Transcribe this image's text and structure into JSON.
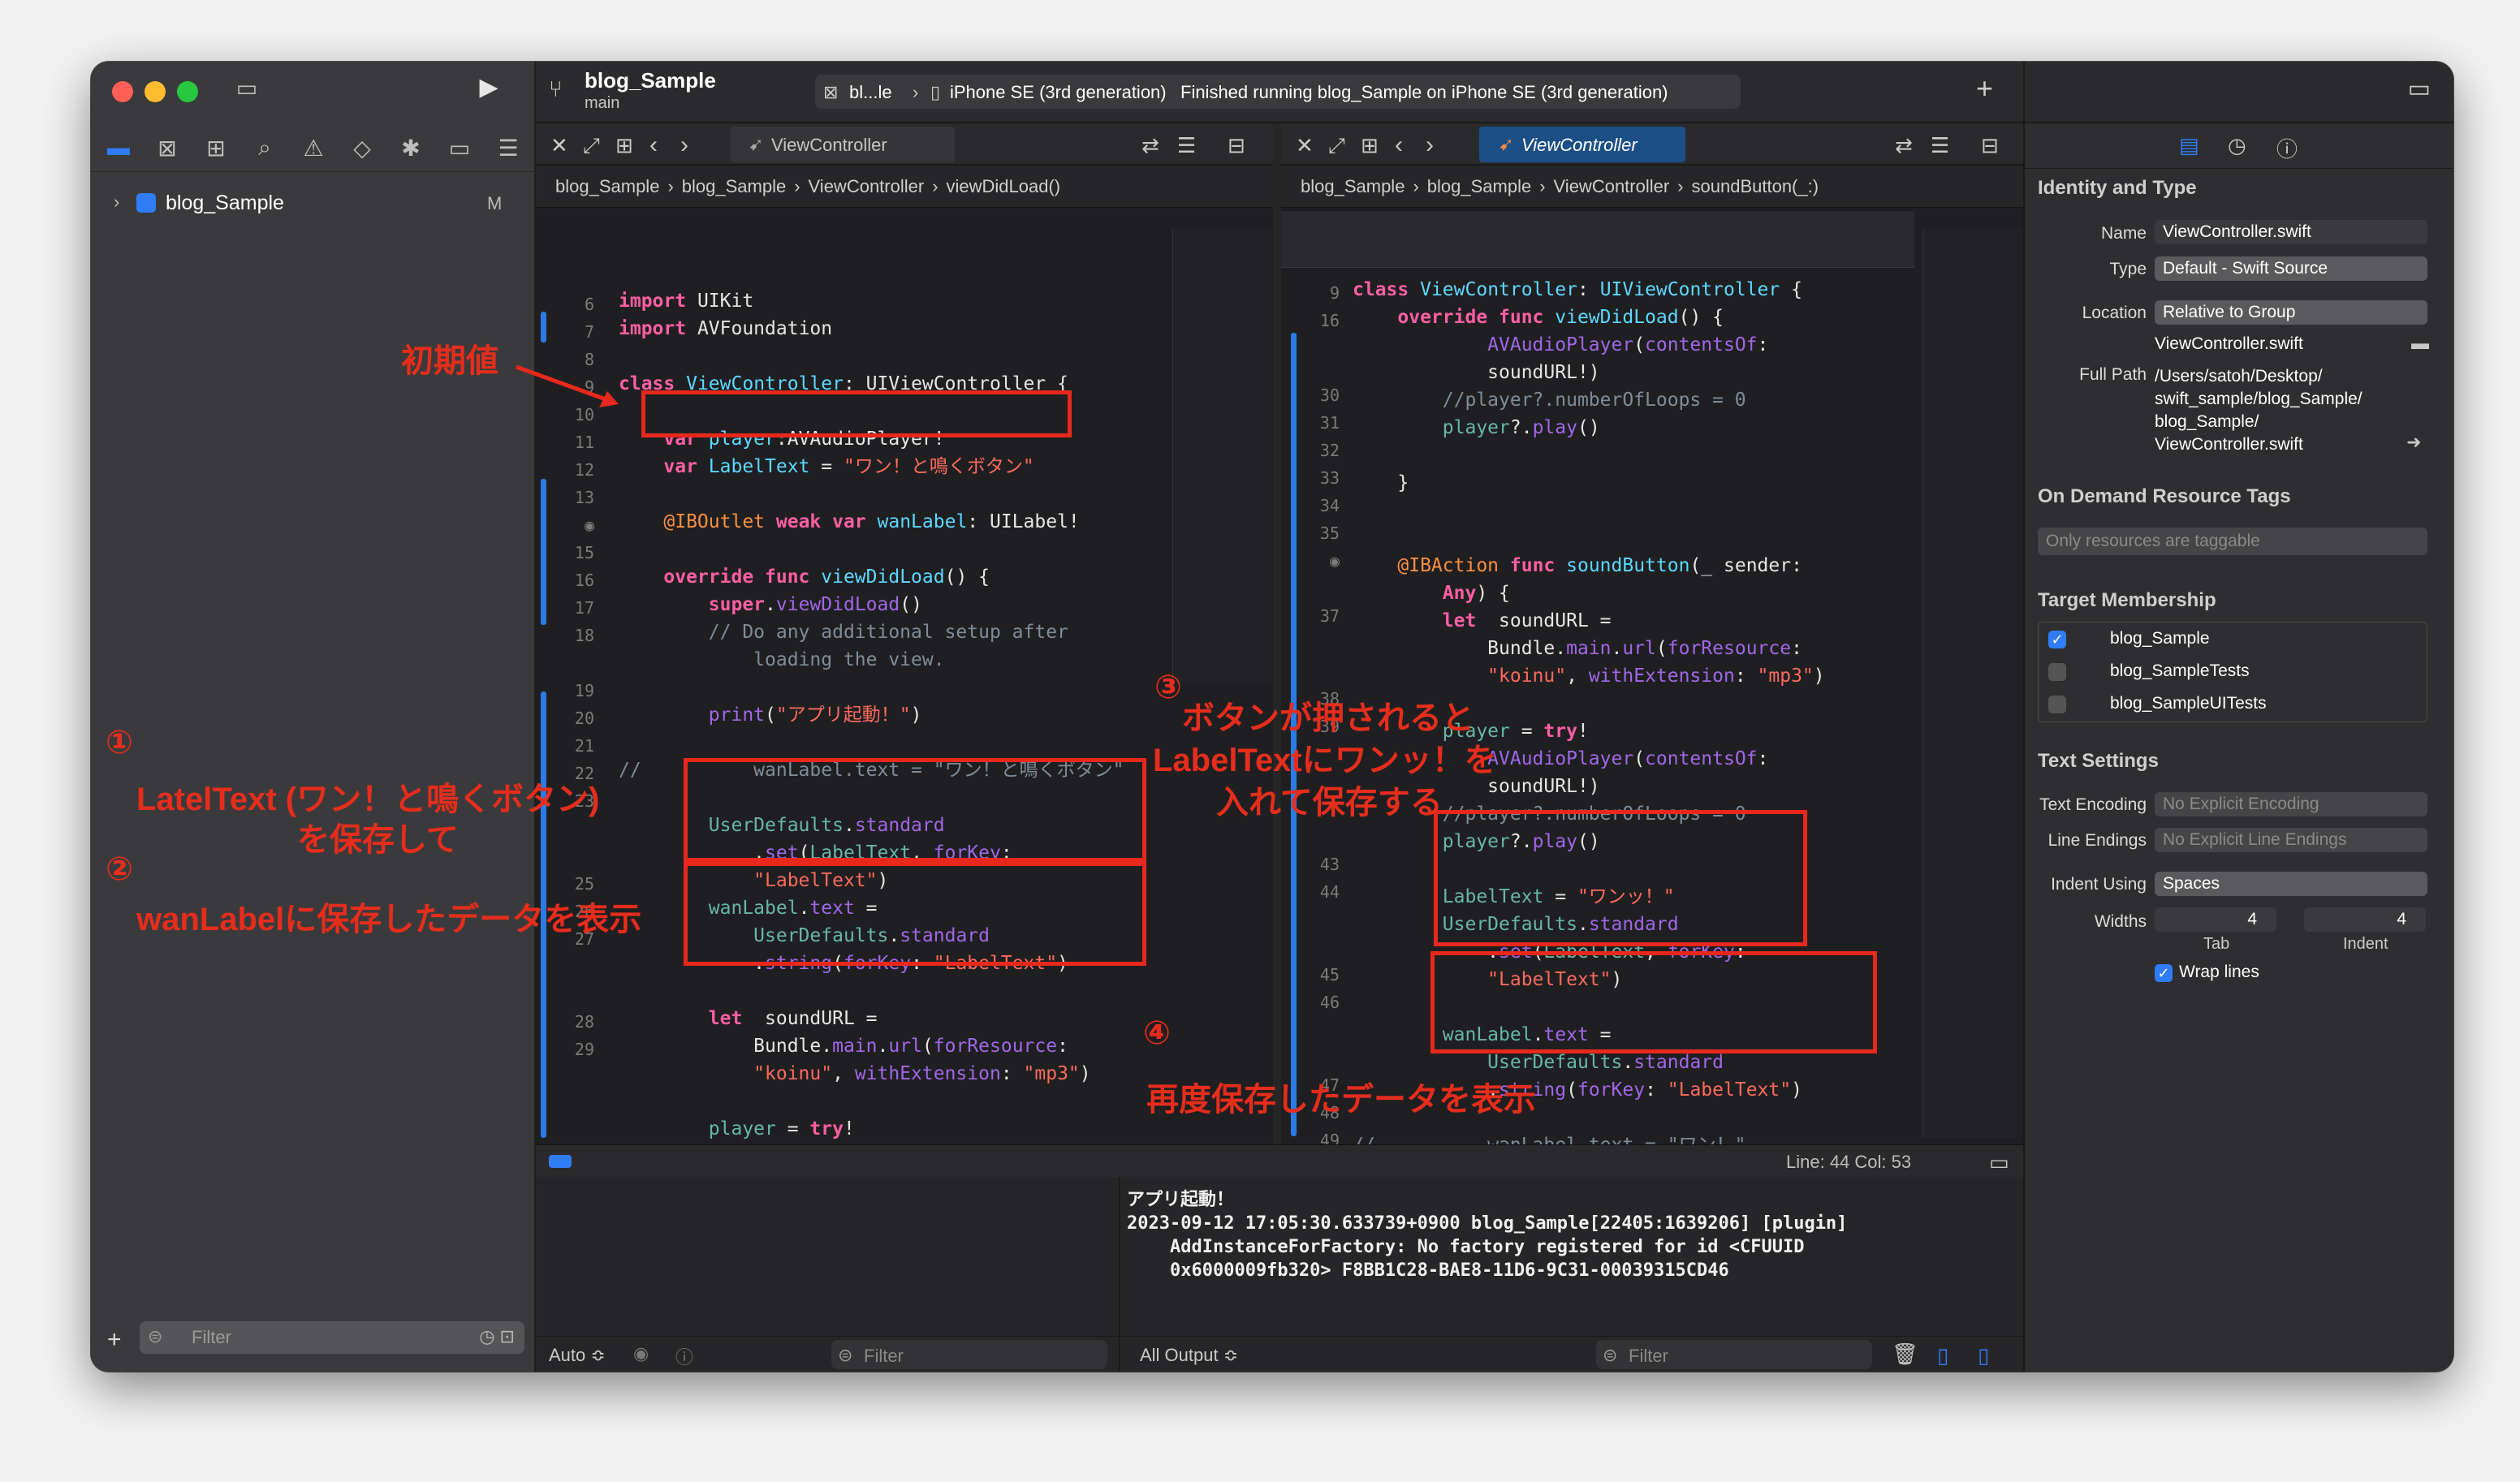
{
  "window": {
    "project": "blog_Sample",
    "branch": "main",
    "scheme": "bl...le",
    "device": "iPhone SE (3rd generation)",
    "status": "Finished running blog_Sample on iPhone SE (3rd generation)"
  },
  "navigator": {
    "project_item": "blog_Sample",
    "project_badge": "M",
    "filter_placeholder": "Filter"
  },
  "left_editor": {
    "tab": "ViewController",
    "breadcrumb": [
      "blog_Sample",
      "blog_Sample",
      "ViewController",
      "viewDidLoad()"
    ]
  },
  "right_editor": {
    "tab": "ViewController",
    "breadcrumb": [
      "blog_Sample",
      "blog_Sample",
      "ViewController",
      "soundButton(_:)"
    ]
  },
  "status_bar": {
    "position": "Line: 44  Col: 53"
  },
  "debug": {
    "auto_label": "Auto ≎",
    "filter_placeholder": "Filter",
    "output_label": "All Output ≎",
    "console_lines": [
      "アプリ起動！",
      "2023-09-12 17:05:30.633739+0900 blog_Sample[22405:1639206] [plugin]",
      "    AddInstanceForFactory: No factory registered for id <CFUUID",
      "    0x6000009fb320> F8BB1C28-BAE8-11D6-9C31-00039315CD46"
    ]
  },
  "annotations": {
    "initial": "初期値",
    "n1": "①",
    "n1_text_a": "LatelText (ワン！と鳴くボタン)",
    "n1_text_b": "を保存して",
    "n2": "②",
    "n2_text": "wanLabelに保存したデータを表示",
    "n3": "③",
    "n3_text_a": "ボタンが押されると",
    "n3_text_b": "LabelTextにワンッ！を",
    "n3_text_c": "入れて保存する",
    "n4": "④",
    "n4_text": "再度保存したデータを表示"
  },
  "inspector": {
    "identity_title": "Identity and Type",
    "name_label": "Name",
    "name_value": "ViewController.swift",
    "type_label": "Type",
    "type_value": "Default - Swift Source",
    "location_label": "Location",
    "location_value": "Relative to Group",
    "location_file": "ViewController.swift",
    "fullpath_label": "Full Path",
    "fullpath_lines": [
      "/Users/satoh/Desktop/",
      "swift_sample/blog_Sample/",
      "blog_Sample/",
      "ViewController.swift"
    ],
    "ondemand_title": "On Demand Resource Tags",
    "ondemand_placeholder": "Only resources are taggable",
    "target_title": "Target Membership",
    "targets": [
      "blog_Sample",
      "blog_SampleTests",
      "blog_SampleUITests"
    ],
    "text_settings_title": "Text Settings",
    "encoding_label": "Text Encoding",
    "encoding_value": "No Explicit Encoding",
    "line_endings_label": "Line Endings",
    "line_endings_value": "No Explicit Line Endings",
    "indent_label": "Indent Using",
    "indent_value": "Spaces",
    "widths_label": "Widths",
    "tab_value": "4",
    "indent_width_value": "4",
    "tab_caption": "Tab",
    "indent_caption": "Indent",
    "wrap_label": "Wrap lines"
  },
  "colors": {
    "accent": "#2f7cf6",
    "annotation": "#e62d1c"
  }
}
